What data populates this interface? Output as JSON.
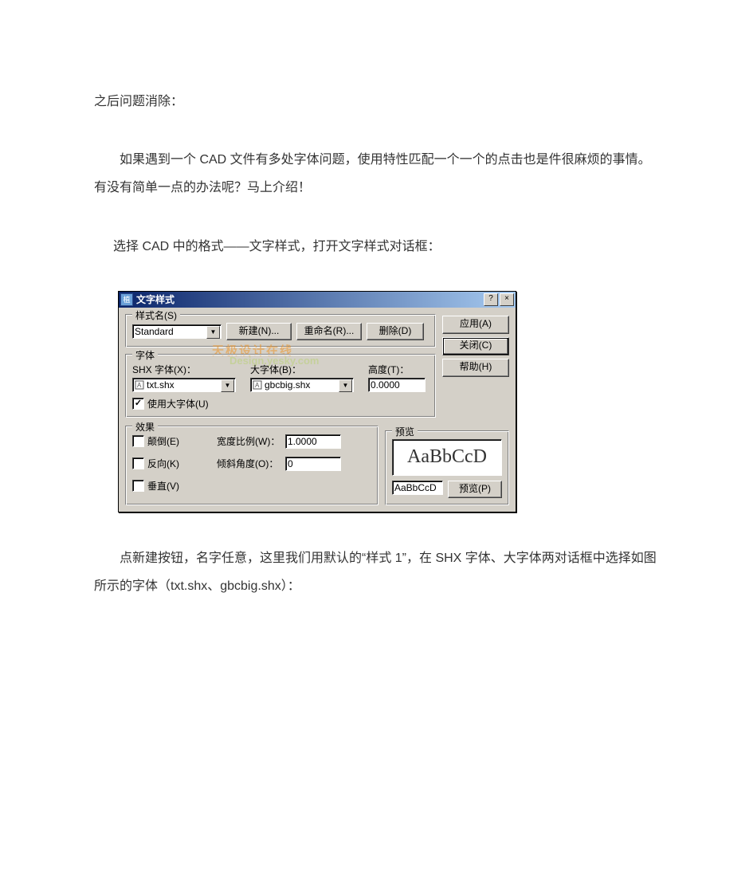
{
  "doc": {
    "p1": "之后问题消除：",
    "p2": "如果遇到一个 CAD 文件有多处字体问题，使用特性匹配一个一个的点击也是件很麻烦的事情。有没有简单一点的办法呢？马上介绍！",
    "p3": "选择 CAD 中的格式——文字样式，打开文字样式对话框：",
    "p4": "点新建按钮，名字任意，这里我们用默认的“样式 1”，在 SHX 字体、大字体两对话框中选择如图所示的字体（txt.shx、gbcbig.shx）："
  },
  "dialog": {
    "title": "文字样式",
    "buttons": {
      "help_q": "?",
      "close_x": "×",
      "apply": "应用(A)",
      "close": "关闭(C)",
      "help": "帮助(H)",
      "new": "新建(N)...",
      "rename": "重命名(R)...",
      "delete": "删除(D)",
      "preview": "预览(P)"
    },
    "groups": {
      "stylename": "样式名(S)",
      "font": "字体",
      "effects": "效果",
      "preview": "预览"
    },
    "labels": {
      "shx_font": "SHX 字体(X)：",
      "big_font": "大字体(B)：",
      "height": "高度(T)：",
      "width_factor": "宽度比例(W)：",
      "oblique": "倾斜角度(O)："
    },
    "values": {
      "style_name": "Standard",
      "shx_font": "txt.shx",
      "big_font": "gbcbig.shx",
      "height": "0.0000",
      "width_factor": "1.0000",
      "oblique": "0",
      "preview_text": "AaBbCcD",
      "preview_input": "AaBbCcD"
    },
    "checks": {
      "use_big_font": "使用大字体(U)",
      "upside_down": "颠倒(E)",
      "backwards": "反向(K)",
      "vertical": "垂直(V)"
    },
    "watermark": {
      "line1": "天极设计在线",
      "line2": "Design.yesky.com"
    }
  }
}
